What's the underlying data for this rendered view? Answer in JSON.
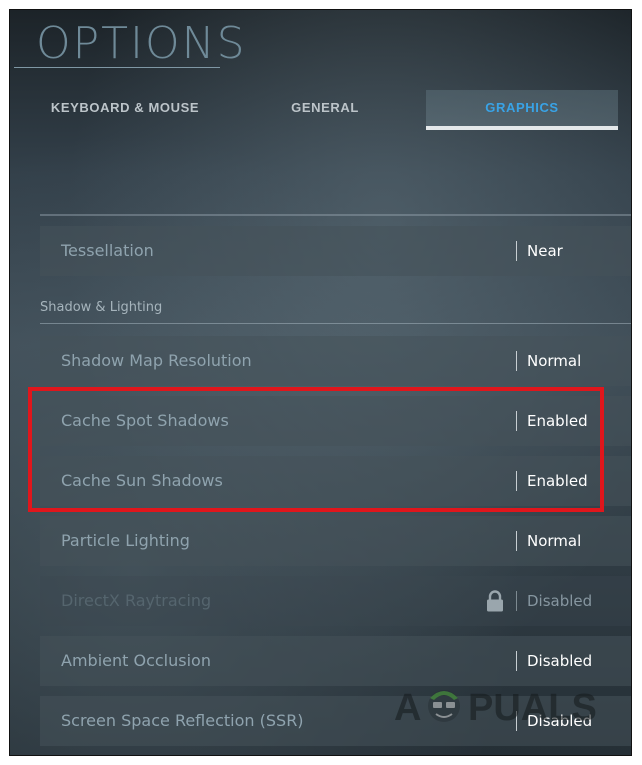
{
  "header": {
    "title": "OPTIONS"
  },
  "tabs": [
    {
      "label": "KEYBOARD & MOUSE",
      "active": false
    },
    {
      "label": "GENERAL",
      "active": false
    },
    {
      "label": "GRAPHICS",
      "active": true
    }
  ],
  "settings": {
    "tessellation": {
      "label": "Tessellation",
      "value": "Near"
    },
    "section_shadow_lighting": "Shadow & Lighting",
    "rows": [
      {
        "label": "Shadow Map Resolution",
        "value": "Normal",
        "disabled": false
      },
      {
        "label": "Cache Spot Shadows",
        "value": "Enabled",
        "disabled": false
      },
      {
        "label": "Cache Sun Shadows",
        "value": "Enabled",
        "disabled": false
      },
      {
        "label": "Particle Lighting",
        "value": "Normal",
        "disabled": false
      },
      {
        "label": "DirectX Raytracing",
        "value": "Disabled",
        "disabled": true,
        "locked": true
      },
      {
        "label": "Ambient Occlusion",
        "value": "Disabled",
        "disabled": false
      },
      {
        "label": "Screen Space Reflection (SSR)",
        "value": "Disabled",
        "disabled": false
      }
    ]
  },
  "watermark": {
    "text": "APPUALS"
  },
  "colors": {
    "active_tab": "#39a3e6",
    "highlight_box": "#e0161c",
    "title": "#6f8a98"
  },
  "icons": {
    "lock": "lock-icon"
  }
}
